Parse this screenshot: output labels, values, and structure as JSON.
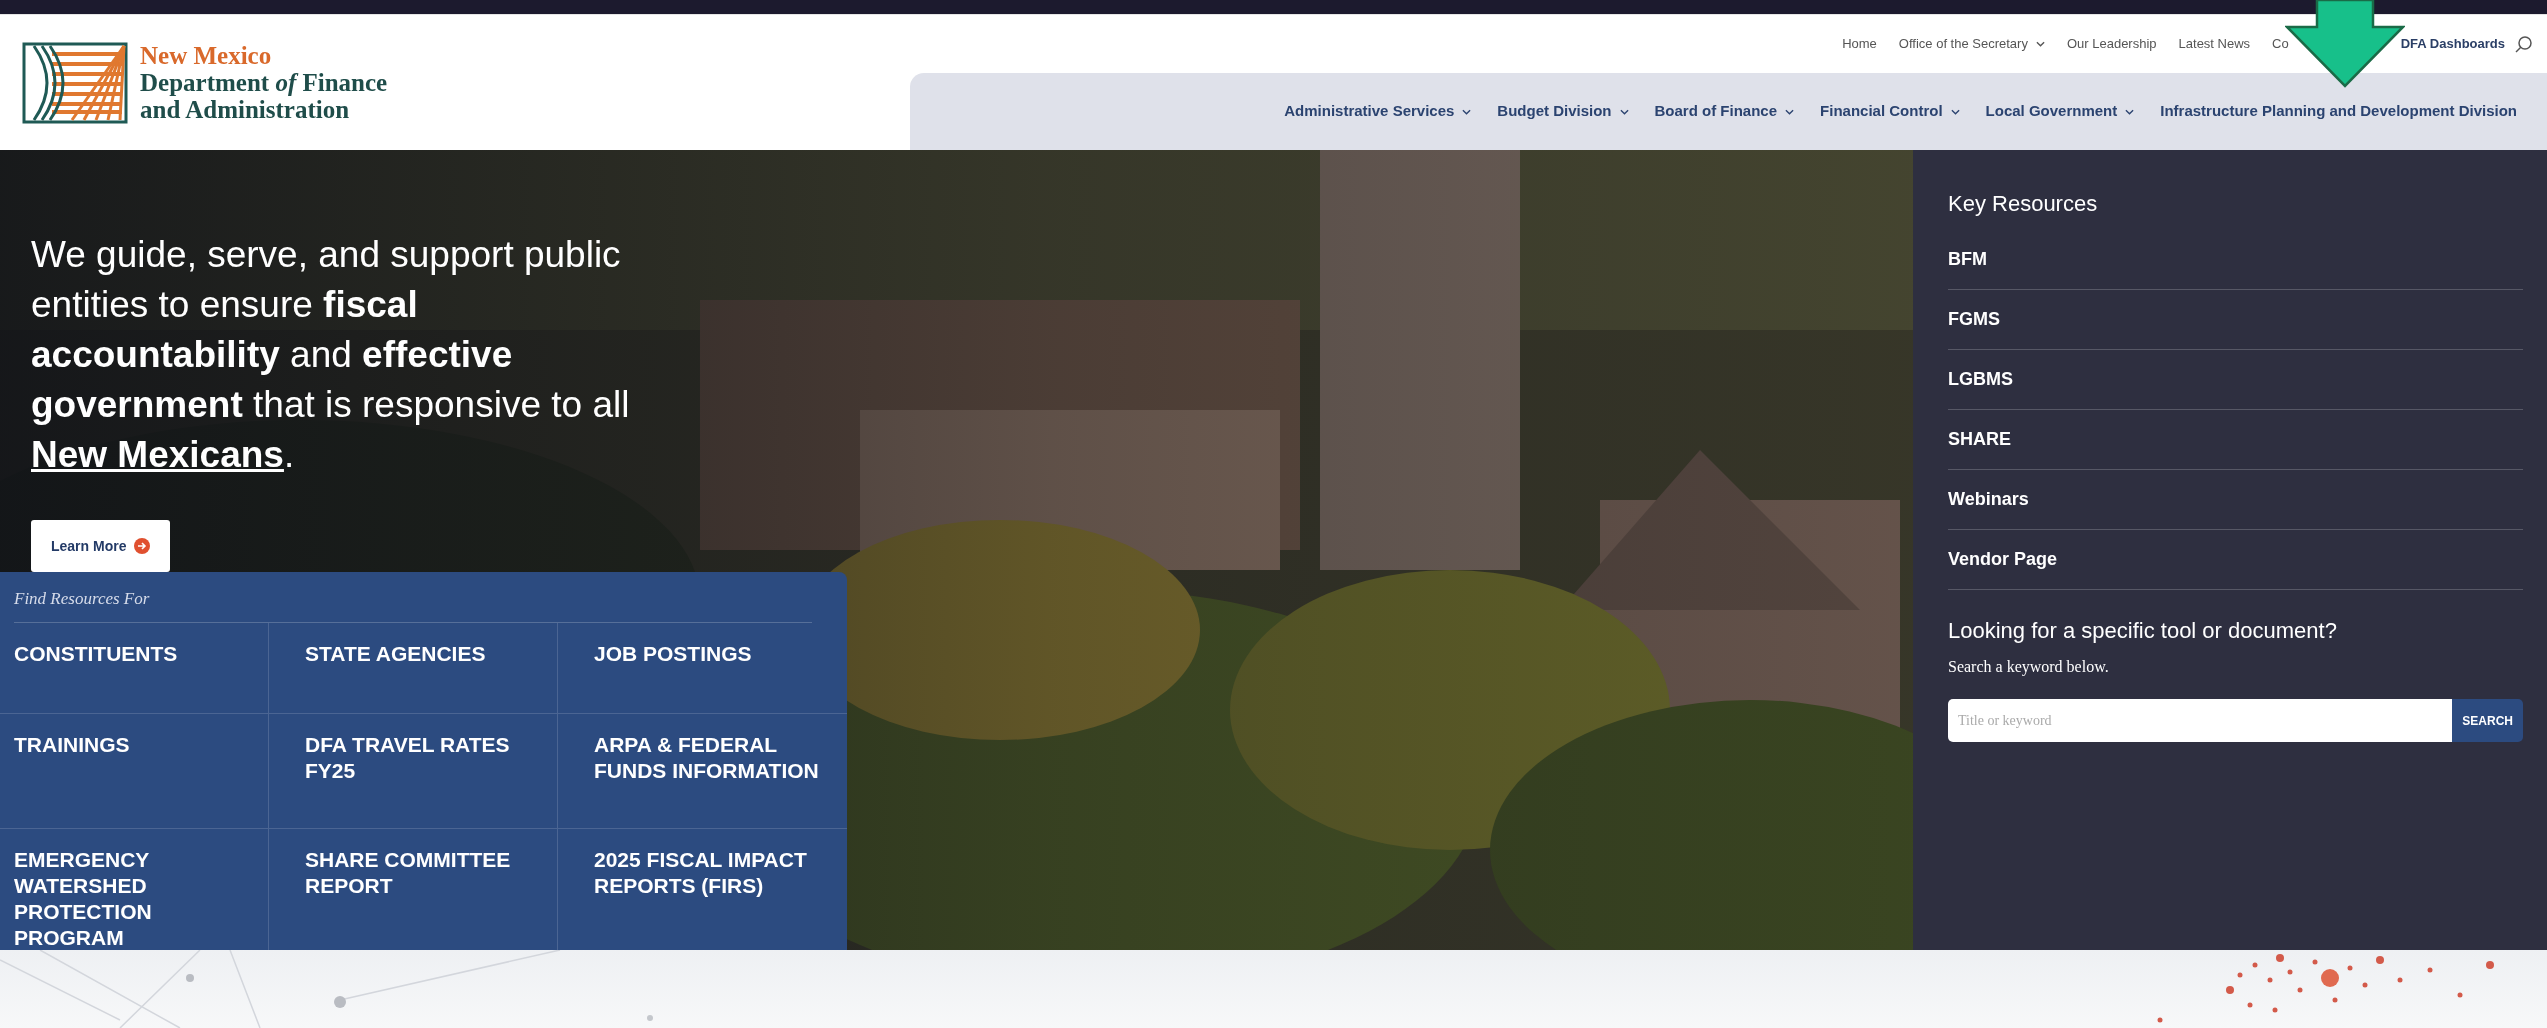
{
  "header": {
    "logo": {
      "line1": "New Mexico",
      "line2": "Department *of* Finance",
      "line3": "and Administration"
    },
    "utility_links": [
      {
        "label": "Home",
        "has_menu": false,
        "bold": false
      },
      {
        "label": "Office of the Secretary",
        "has_menu": true,
        "bold": false
      },
      {
        "label": "Our Leadership",
        "has_menu": false,
        "bold": false
      },
      {
        "label": "Latest News",
        "has_menu": false,
        "bold": false
      },
      {
        "label": "Co",
        "has_menu": false,
        "bold": false
      },
      {
        "label": "DFA Dashboards",
        "has_menu": false,
        "bold": true
      }
    ],
    "main_nav": [
      {
        "label": "Administrative Services",
        "has_menu": true
      },
      {
        "label": "Budget Division",
        "has_menu": true
      },
      {
        "label": "Board of Finance",
        "has_menu": true
      },
      {
        "label": "Financial Control",
        "has_menu": true
      },
      {
        "label": "Local Government",
        "has_menu": true
      },
      {
        "label": "Infrastructure Planning and Development Division",
        "has_menu": false
      }
    ]
  },
  "hero": {
    "headline": "We guide, serve, and support public entities to ensure **fiscal accountability** and **effective government** that is responsive to all ",
    "headline_link": "New Mexicans",
    "headline_end": ".",
    "button": "Learn More"
  },
  "find_resources": {
    "title": "Find Resources For",
    "links": [
      {
        "label": "CONSTITUENTS"
      },
      {
        "label": "STATE AGENCIES"
      },
      {
        "label": "JOB POSTINGS"
      },
      {
        "label": "TRAININGS"
      },
      {
        "label": "DFA TRAVEL RATES FY25"
      },
      {
        "label": "ARPA & FEDERAL FUNDS INFORMATION"
      },
      {
        "label": "EMERGENCY WATERSHED PROTECTION PROGRAM"
      },
      {
        "label": "SHARE COMMITTEE REPORT"
      },
      {
        "label": "2025 FISCAL IMPACT REPORTS (FIRS)"
      }
    ]
  },
  "key_resources": {
    "title": "Key Resources",
    "items": [
      "BFM",
      "FGMS",
      "LGBMS",
      "SHARE",
      "Webinars",
      "Vendor Page"
    ],
    "search_title": "Looking for a specific tool or document?",
    "search_hint": "Search a keyword below.",
    "search": {
      "placeholder": "Title or keyword"
    },
    "search_button": "SEARCH"
  }
}
